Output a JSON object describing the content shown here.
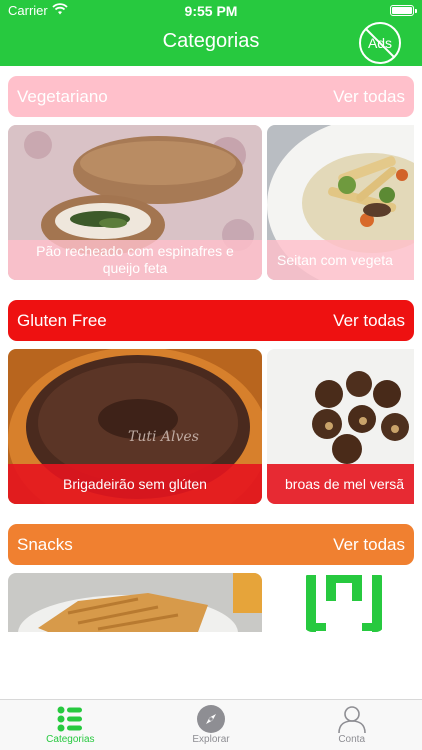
{
  "status_bar": {
    "carrier": "Carrier",
    "time": "9:55 PM"
  },
  "header": {
    "title": "Categorias",
    "ads_label": "Ads"
  },
  "colors": {
    "brand_green": "#27c93f",
    "vegetariano": "#ffc0cb",
    "gluten_free": "#ee1111",
    "snacks": "#f08030"
  },
  "sections": [
    {
      "title": "Vegetariano",
      "see_all": "Ver todas",
      "items": [
        {
          "caption": "Pão recheado com espinafres e queijo feta"
        },
        {
          "caption": "Seitan com vegeta"
        }
      ]
    },
    {
      "title": "Gluten Free",
      "see_all": "Ver todas",
      "items": [
        {
          "caption": "Brigadeirão sem glúten"
        },
        {
          "caption": "broas de mel versã"
        }
      ]
    },
    {
      "title": "Snacks",
      "see_all": "Ver todas",
      "items": []
    }
  ],
  "tabs": [
    {
      "label": "Categorias",
      "icon": "list-icon",
      "active": true
    },
    {
      "label": "Explorar",
      "icon": "compass-icon",
      "active": false
    },
    {
      "label": "Conta",
      "icon": "person-icon",
      "active": false
    }
  ]
}
